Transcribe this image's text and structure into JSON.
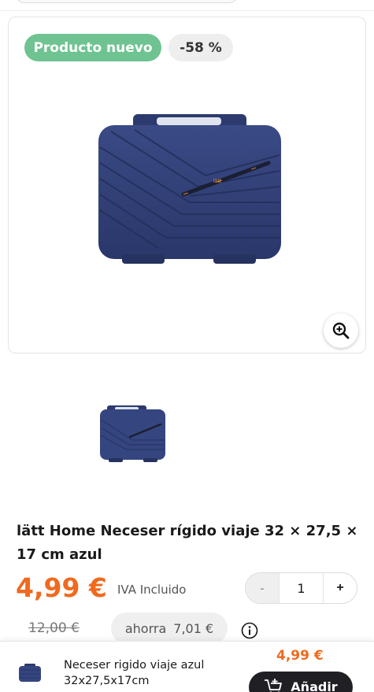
{
  "product": {
    "badges": {
      "new": "Producto nuevo",
      "discount": "-58 %"
    },
    "brand_print": "lätt",
    "title": "lätt Home Neceser rígido viaje 32 × 27,5 × 17 cm azul",
    "price": "4,99 €",
    "vat_note": "IVA Incluido",
    "quantity": "1",
    "quantity_minus": "-",
    "quantity_plus": "+",
    "old_price": "12,00 €",
    "savings_label": "ahorra",
    "savings_amount": "7,01 €"
  },
  "sticky_bar": {
    "name": "Neceser rigido viaje azul 32x27,5x17cm",
    "price": "4,99 €",
    "add_label": "Añadir"
  },
  "icons": [
    "zoom-in-icon",
    "info-icon",
    "cart-add-icon"
  ],
  "colors": {
    "accent_price": "#ef6a1f",
    "badge_new": "#6fc391",
    "product_blue": "#2f3f78",
    "button_dark": "#1f1f24"
  }
}
